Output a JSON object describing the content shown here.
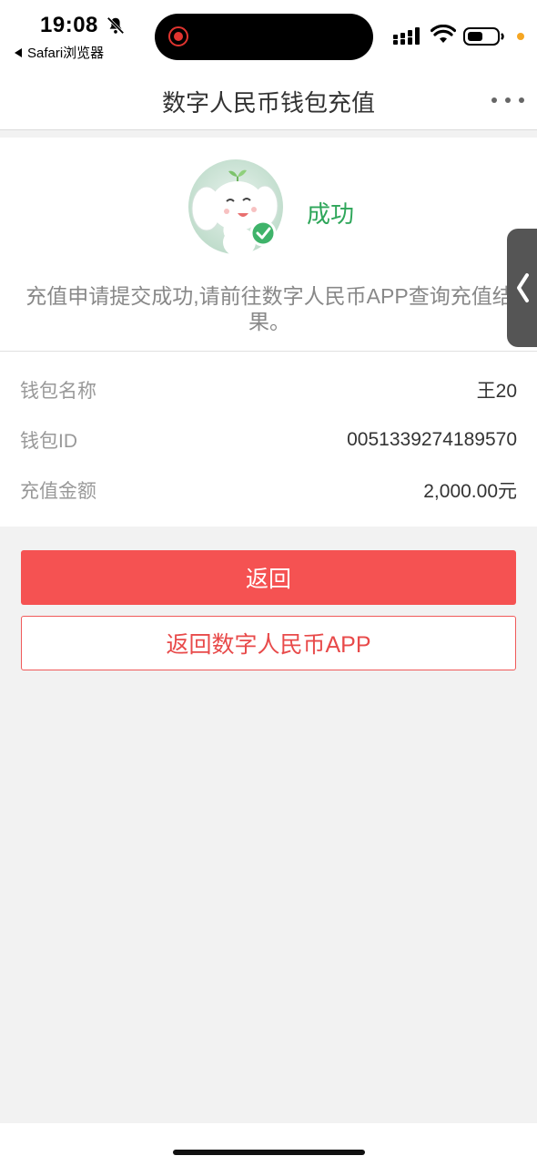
{
  "status_bar": {
    "time": "19:08",
    "back_app_label": "Safari浏览器",
    "icons": [
      "bell-off-icon",
      "record-icon",
      "signal-icon",
      "wifi-icon",
      "battery-icon"
    ]
  },
  "nav": {
    "title": "数字人民币钱包充值",
    "more_icon": "more-dots-icon"
  },
  "result": {
    "status": "成功",
    "message": "充值申请提交成功,请前往数字人民币APP查询充值结果。",
    "status_color": "#2ea65a"
  },
  "details": [
    {
      "label": "钱包名称",
      "value": "王20"
    },
    {
      "label": "钱包ID",
      "value": "0051339274189570"
    },
    {
      "label": "充值金额",
      "value": "2,000.00元"
    }
  ],
  "actions": {
    "back_label": "返回",
    "back_to_app_label": "返回数字人民币APP",
    "primary_color": "#f55252"
  }
}
